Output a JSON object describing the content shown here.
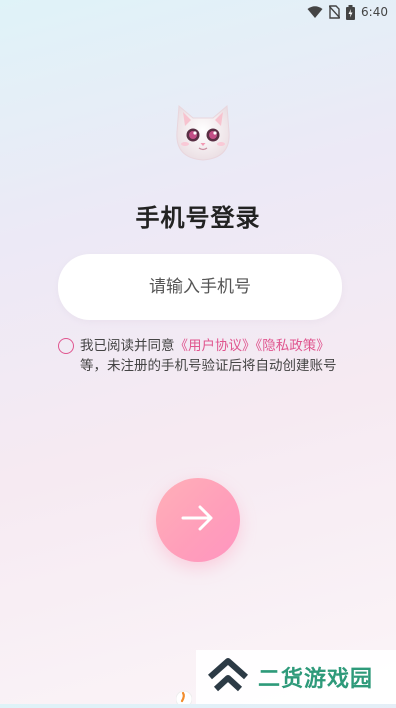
{
  "status_bar": {
    "time": "6:40",
    "icons": [
      "wifi-icon",
      "no-sim-icon",
      "battery-charging-icon"
    ]
  },
  "logo": {
    "icon": "cat-mascot-icon"
  },
  "page": {
    "title": "手机号登录"
  },
  "phone_input": {
    "placeholder": "请输入手机号",
    "value": ""
  },
  "agreement": {
    "checked": false,
    "prefix": "我已阅读并同意",
    "user_agreement": "《用户协议》",
    "privacy_policy": "《隐私政策》",
    "suffix": "等，未注册的手机号验证后将自动创建账号"
  },
  "next_button": {
    "icon": "arrow-right-icon"
  },
  "watermark": {
    "text": "二货游戏园",
    "icon": "chevron-up-logo-icon"
  },
  "colors": {
    "accent": "#e0568f",
    "button_gradient_start": "#ffb0b8",
    "button_gradient_end": "#ff95c0",
    "watermark_green": "#2e9a7a"
  }
}
